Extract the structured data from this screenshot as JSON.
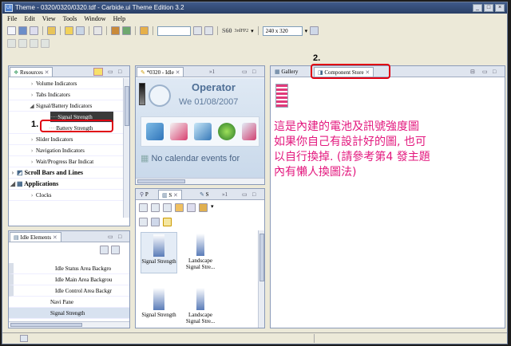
{
  "window": {
    "title": "Theme - 0320/0320/0320.tdf - Carbide.ui Theme Edition 3.2",
    "controls": [
      "_",
      "□",
      "×"
    ]
  },
  "menu": [
    "File",
    "Edit",
    "View",
    "Tools",
    "Window",
    "Help"
  ],
  "toolbar": {
    "zoom_label": "S60",
    "platform": "3rdFP2",
    "resolution": "240 x 320"
  },
  "resources_panel": {
    "tab": "Resources",
    "items": [
      {
        "label": "Volume Indicators",
        "level": 2
      },
      {
        "label": "Tabs Indicators",
        "level": 2
      },
      {
        "label": "Signal/Battery Indicators",
        "level": 2,
        "expanded": true
      },
      {
        "label": "Signal Strength",
        "level": 3,
        "selected": true
      },
      {
        "label": "Battery Strength",
        "level": 3
      },
      {
        "label": "Slider Indicators",
        "level": 2
      },
      {
        "label": "Navigation Indicators",
        "level": 2
      },
      {
        "label": "Wait/Progress Bar Indicat",
        "level": 2
      },
      {
        "label": "Scroll Bars and Lines",
        "level": 1,
        "bold": true
      },
      {
        "label": "Applications",
        "level": 1,
        "bold": true,
        "expanded": true
      },
      {
        "label": "Clocks",
        "level": 2
      }
    ]
  },
  "idle_editor": {
    "tab": "*0320 - Idle",
    "overflow": "»1",
    "operator": "Operator",
    "date": "We 01/08/2007",
    "calendar": "No calendar events for"
  },
  "idle_elements": {
    "tab": "Idle Elements",
    "items": [
      "Idle Status Area Backgro",
      "Idle Main Area Backgrou",
      "Idle Control Area Backgr",
      "Navi Pane",
      "Signal Strength"
    ]
  },
  "mini_panel": {
    "tabs": [
      "P",
      "S",
      "S"
    ],
    "overflow": "»1",
    "thumbs": [
      {
        "label": "Signal Strength"
      },
      {
        "label": "Landscape Signal Stre..."
      },
      {
        "label": "Signal Strength"
      },
      {
        "label": "Landscape Signal Stre..."
      }
    ]
  },
  "gallery": {
    "tab_gallery": "Gallery",
    "tab_component": "Component Store",
    "swatch_colors": [
      "#e8c93a",
      "#d4b12a",
      "#c9c9c9",
      "#f2dc3e",
      "#2a2a2a",
      "#3c3c3c",
      "#1db4b4",
      "#e03a7a"
    ]
  },
  "annotation": {
    "label1": "1.",
    "label2": "2.",
    "lines": [
      "這是內建的電池及訊號強度圖",
      "如果你自己有設計好的圖, 也可",
      "以自行換掉. (請參考第4  發主題",
      "內有懶人換圖法)"
    ]
  }
}
